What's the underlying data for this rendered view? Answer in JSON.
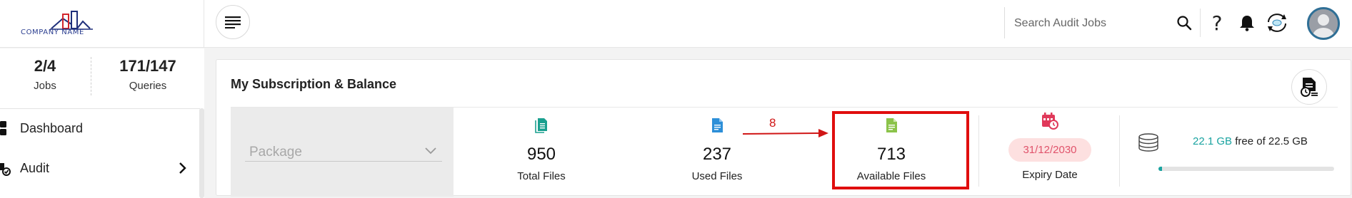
{
  "header": {
    "logo_text": "COMPANY NAME",
    "search_placeholder": "Search Audit Jobs",
    "help_glyph": "?",
    "icons": [
      "menu-icon",
      "search-icon",
      "help-icon",
      "bell-icon",
      "sync-icon",
      "avatar"
    ]
  },
  "sidebar": {
    "stats": [
      {
        "value": "2/4",
        "label": "Jobs"
      },
      {
        "value": "171/147",
        "label": "Queries"
      }
    ],
    "items": [
      {
        "label": "Dashboard",
        "icon": "dashboard-icon"
      },
      {
        "label": "Audit",
        "icon": "audit-icon",
        "has_submenu": true
      }
    ]
  },
  "subscription": {
    "title": "My Subscription & Balance",
    "package_placeholder": "Package",
    "metrics": [
      {
        "value": "950",
        "label": "Total Files",
        "icon": "total-files-icon",
        "color": "#1aa08f"
      },
      {
        "value": "237",
        "label": "Used Files",
        "icon": "used-files-icon",
        "color": "#2d8fd8"
      },
      {
        "value": "713",
        "label": "Available Files",
        "icon": "available-files-icon",
        "color": "#8bc34a"
      }
    ],
    "annotation": "8",
    "expiry": {
      "date": "31/12/2030",
      "label": "Expiry Date"
    },
    "storage": {
      "used": "22.1 GB",
      "rest": " free of 22.5 GB",
      "fill_fraction": 0.02
    }
  },
  "colors": {
    "accent_teal": "#19a3a0",
    "annotation_red": "#e00e0e",
    "expiry_pink": "#fde0e0"
  }
}
